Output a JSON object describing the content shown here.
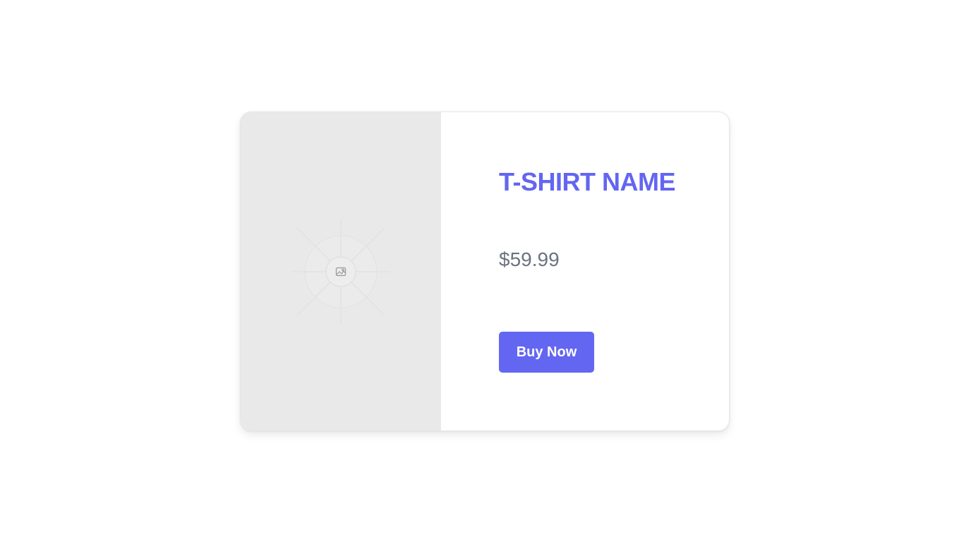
{
  "product": {
    "name": "T-SHIRT NAME",
    "price": "$59.99",
    "buy_label": "Buy Now",
    "image_icon": "image-placeholder-icon"
  },
  "colors": {
    "accent": "#6366f1",
    "price_text": "#6b7280",
    "image_bg": "#e9e9e9"
  }
}
